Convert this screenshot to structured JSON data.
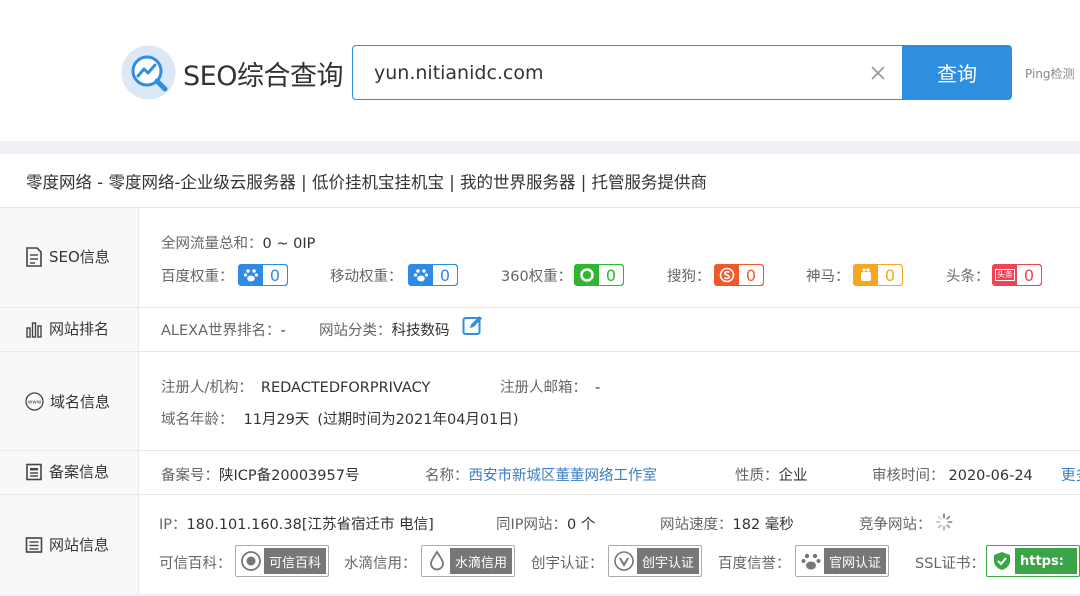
{
  "header": {
    "logo_text": "SEO综合查询",
    "search_value": "yun.nitianidc.com",
    "search_button": "查询",
    "ping_link": "Ping检测"
  },
  "site_title": "零度网络 - 零度网络-企业级云服务器 | 低价挂机宝挂机宝 | 我的世界服务器 | 托管服务提供商",
  "seo": {
    "label": "SEO信息",
    "traffic_label": "全网流量总和：",
    "traffic_value": "0 ~ 0IP",
    "weights": [
      {
        "label": "百度权重：",
        "value": "0",
        "icon": "baidu-paw-icon",
        "color": "#2f8ae5"
      },
      {
        "label": "移动权重：",
        "value": "0",
        "icon": "baidu-mobile-paw-icon",
        "color": "#2f8ae5"
      },
      {
        "label": "360权重：",
        "value": "0",
        "icon": "360-icon",
        "color": "#2fb530"
      },
      {
        "label": "搜狗：",
        "value": "0",
        "icon": "sogou-icon",
        "color": "#f05a28"
      },
      {
        "label": "神马：",
        "value": "0",
        "icon": "shenma-icon",
        "color": "#f5a623"
      },
      {
        "label": "头条：",
        "value": "0",
        "icon": "toutiao-icon",
        "color": "#ee4453"
      }
    ],
    "toutiao_icon_text": "头条"
  },
  "rank": {
    "label": "网站排名",
    "alexa_label": "ALEXA世界排名：",
    "alexa_value": "-",
    "category_label": "网站分类：",
    "category_value": "科技数码"
  },
  "domain": {
    "label": "域名信息",
    "icon_text": "www",
    "registrant_label": "注册人/机构：",
    "registrant_value": "REDACTEDFORPRIVACY",
    "email_label": "注册人邮箱：",
    "email_value": "-",
    "age_label": "域名年龄：",
    "age_value": "11月29天",
    "expiry": "(过期时间为2021年04月01日)"
  },
  "beian": {
    "label": "备案信息",
    "number_label": "备案号：",
    "number_value": "陕ICP备20003957号",
    "name_label": "名称：",
    "name_value": "西安市新城区董董网络工作室",
    "nature_label": "性质：",
    "nature_value": "企业",
    "review_label": "审核时间：",
    "review_value": "2020-06-24",
    "more_link": "更多"
  },
  "siteinfo": {
    "label": "网站信息",
    "ip_label": "IP：",
    "ip_value": "180.101.160.38[江苏省宿迁市 电信]",
    "sameip_label": "同IP网站：",
    "sameip_value": "0 个",
    "speed_label": "网站速度：",
    "speed_value": "182 毫秒",
    "competitor_label": "竞争网站：",
    "certs": [
      {
        "label": "可信百科：",
        "badge": "可信百科",
        "icon": "kexin-icon"
      },
      {
        "label": "水滴信用：",
        "badge": "水滴信用",
        "icon": "water-drop-icon"
      },
      {
        "label": "创宇认证：",
        "badge": "创宇认证",
        "icon": "chuangyu-icon"
      },
      {
        "label": "百度信誉：",
        "badge": "官网认证",
        "icon": "baidu-cert-icon"
      },
      {
        "label": "SSL证书：",
        "badge": "https:",
        "icon": "ssl-icon"
      }
    ]
  }
}
